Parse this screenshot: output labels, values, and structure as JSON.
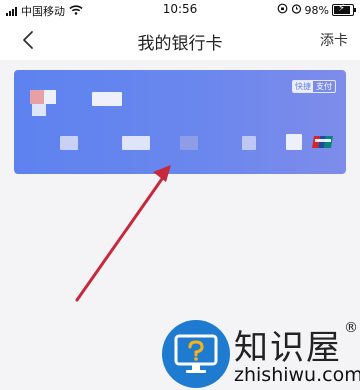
{
  "status_bar": {
    "carrier": "中国移动",
    "time": "10:56",
    "battery_percent": "98%"
  },
  "nav": {
    "title": "我的银行卡",
    "add_card_label": "添卡"
  },
  "card": {
    "quick_pay_part1": "快捷",
    "quick_pay_part2": "支付",
    "network_logo": "UnionPay 银联"
  },
  "watermark": {
    "title": "知识屋",
    "registered": "®",
    "url": "zhishiwu.com"
  },
  "colors": {
    "card_start": "#5d82ef",
    "card_end": "#7e8cea",
    "arrow": "#c8283c",
    "watermark_circle": "#1f7bd0"
  }
}
